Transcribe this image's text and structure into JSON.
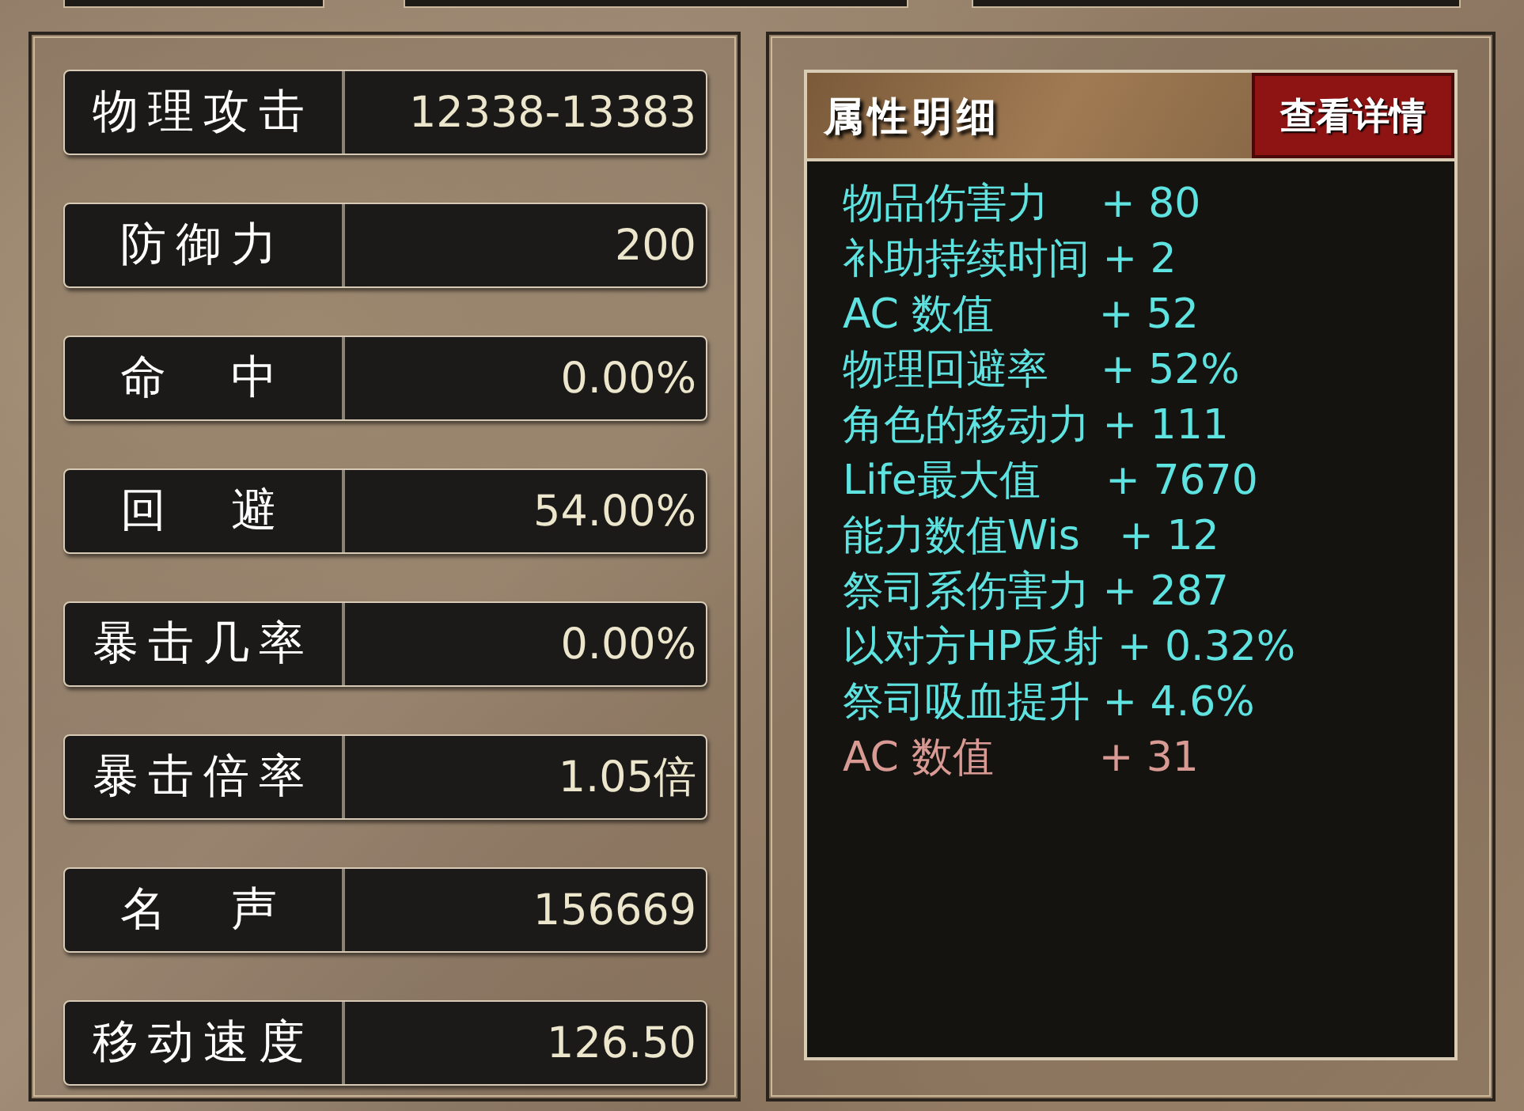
{
  "stats": [
    {
      "label": "物理攻击",
      "value": "12338-13383"
    },
    {
      "label": "防御力",
      "value": "200"
    },
    {
      "label": "命　中",
      "value": "0.00%"
    },
    {
      "label": "回　避",
      "value": "54.00%"
    },
    {
      "label": "暴击几率",
      "value": "0.00%"
    },
    {
      "label": "暴击倍率",
      "value": "1.05倍"
    },
    {
      "label": "名　声",
      "value": "156669"
    },
    {
      "label": "移动速度",
      "value": "126.50"
    }
  ],
  "details": {
    "title": "属性明细",
    "button": "查看详情",
    "lines": [
      {
        "text": "物品伤害力    + 80",
        "color": "#5ee3e0"
      },
      {
        "text": "补助持续时间 + 2",
        "color": "#5ee3e0"
      },
      {
        "text": "AC 数值        + 52",
        "color": "#5ee3e0"
      },
      {
        "text": "物理回避率    + 52%",
        "color": "#5ee3e0"
      },
      {
        "text": "角色的移动力 + 111",
        "color": "#5ee3e0"
      },
      {
        "text": "Life最大值     + 7670",
        "color": "#5ee3e0"
      },
      {
        "text": "能力数值Wis   + 12",
        "color": "#5ee3e0"
      },
      {
        "text": "祭司系伤害力 + 287",
        "color": "#5ee3e0"
      },
      {
        "text": "以对方HP反射 + 0.32%",
        "color": "#5ee3e0"
      },
      {
        "text": "祭司吸血提升 + 4.6%",
        "color": "#5ee3e0"
      },
      {
        "text": "AC 数值        + 31",
        "color": "#d99a94"
      }
    ]
  }
}
